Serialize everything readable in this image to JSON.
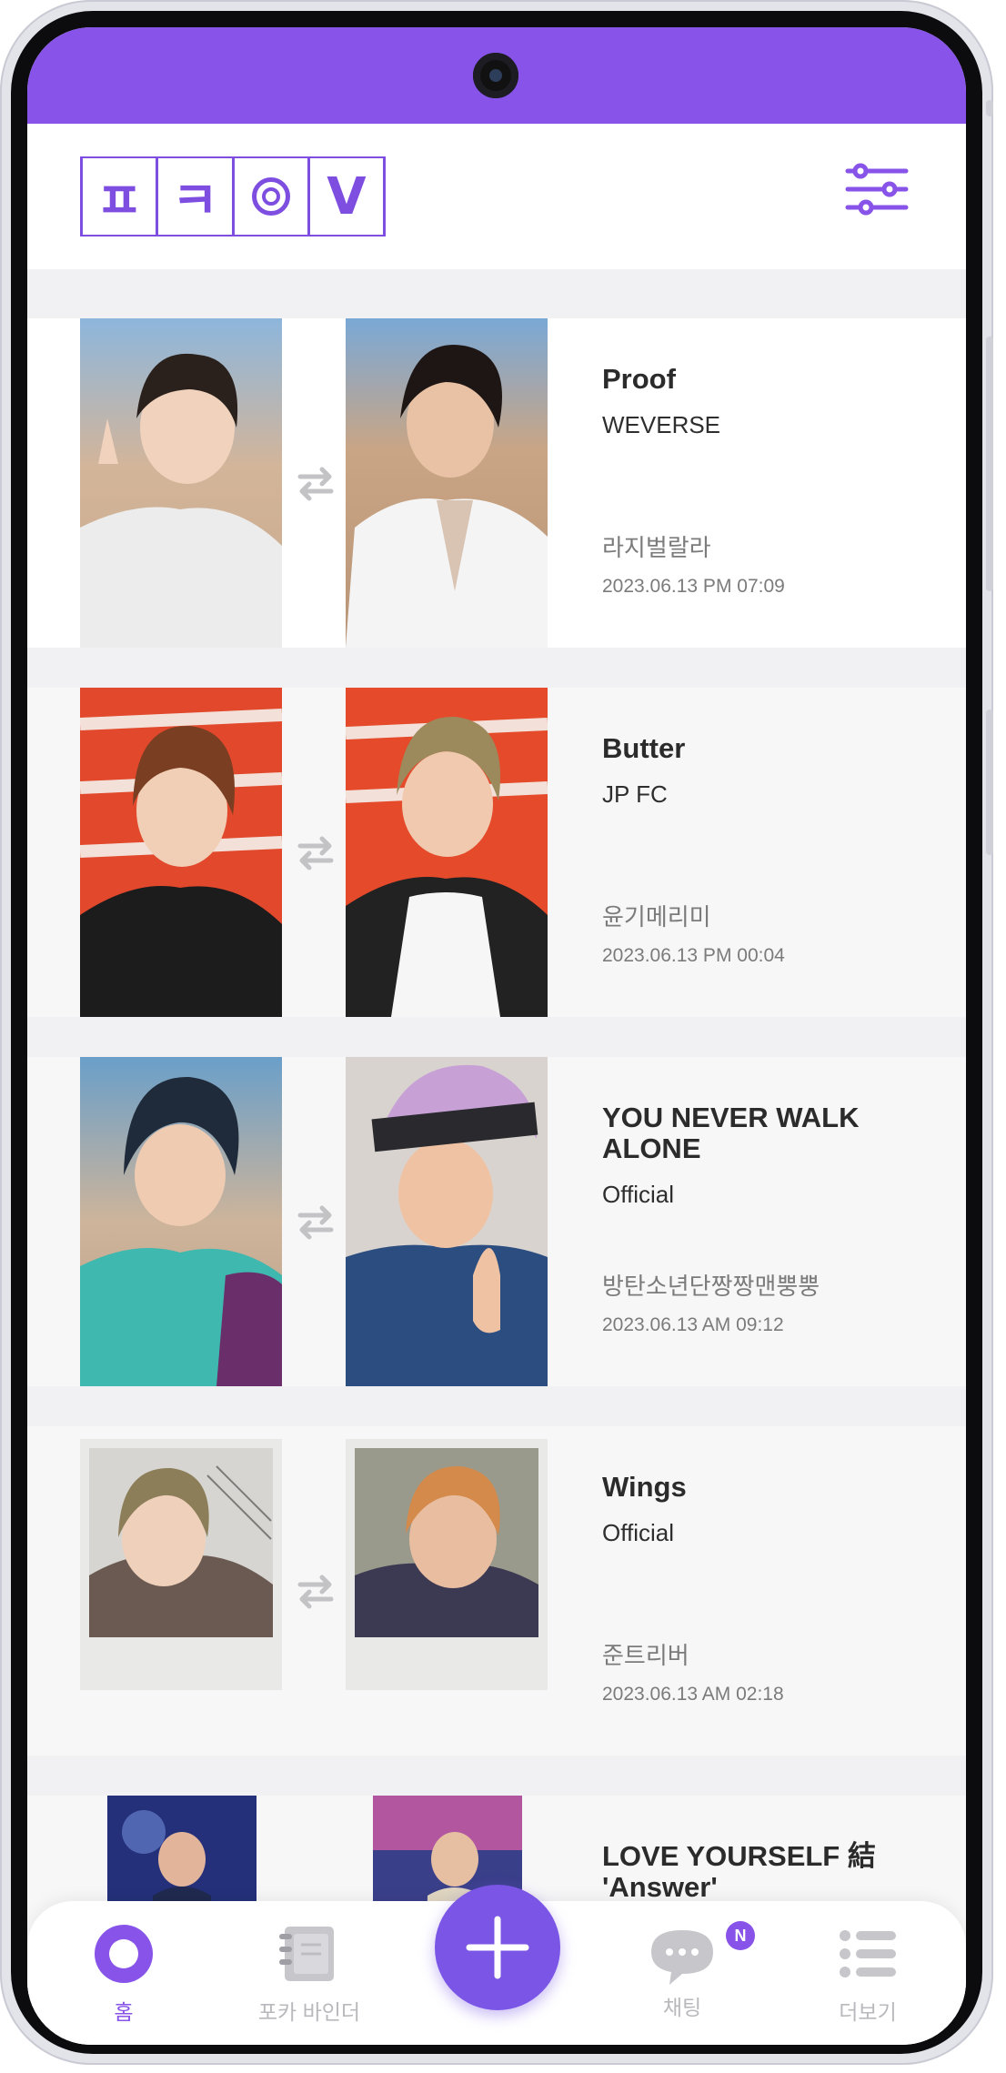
{
  "app": {
    "logo_letters": [
      "ㅍ",
      "ㅋ",
      "",
      "V"
    ],
    "colors": {
      "brand": "#8753e8",
      "fab": "#7a55e6",
      "muted": "#b9b9bd"
    }
  },
  "header": {
    "filter_icon": "sliders-icon"
  },
  "trades": [
    {
      "title": "Proof",
      "source": "WEVERSE",
      "user": "라지벌랄라",
      "datetime": "2023.06.13 PM 07:09"
    },
    {
      "title": "Butter",
      "source": "JP FC",
      "user": "윤기메리미",
      "datetime": "2023.06.13 PM 00:04"
    },
    {
      "title": "YOU NEVER WALK ALONE",
      "source": "Official",
      "user": "방탄소년단짱짱맨뿡뿡",
      "datetime": "2023.06.13 AM 09:12"
    },
    {
      "title": "Wings",
      "source": "Official",
      "user": "준트리버",
      "datetime": "2023.06.13 AM 02:18"
    },
    {
      "title": "LOVE YOURSELF 結 'Answer'"
    }
  ],
  "nav": {
    "home": {
      "label": "홈",
      "icon": "home-ring-icon"
    },
    "binder": {
      "label": "포카 바인더",
      "icon": "binder-icon"
    },
    "add": {
      "icon": "plus-icon"
    },
    "chat": {
      "label": "채팅",
      "icon": "chat-icon",
      "badge": "N"
    },
    "more": {
      "label": "더보기",
      "icon": "list-icon"
    }
  }
}
